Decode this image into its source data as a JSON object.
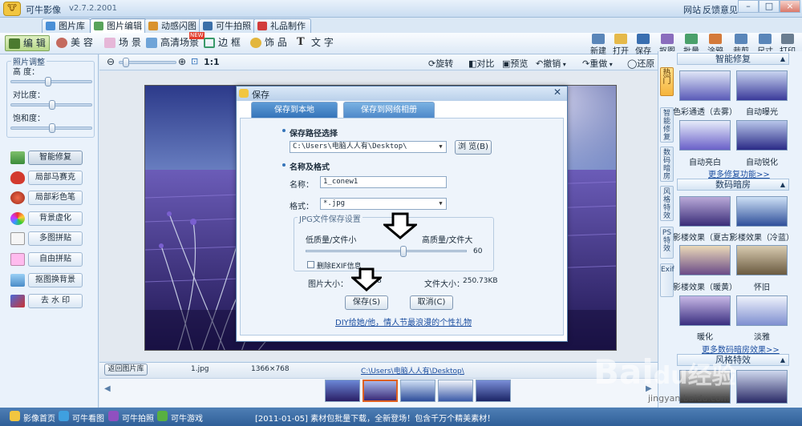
{
  "app": {
    "title": "可牛影像",
    "version": "v2.7.2.2001",
    "logo_icon": "cow-logo-icon"
  },
  "top_tabs": [
    {
      "label": "图片库",
      "icon": "photo-library-icon",
      "active": false
    },
    {
      "label": "图片编辑",
      "icon": "photo-edit-icon",
      "active": true
    },
    {
      "label": "动感闪图",
      "icon": "flash-anim-icon",
      "active": false
    },
    {
      "label": "可牛拍照",
      "icon": "camera-icon",
      "active": false
    },
    {
      "label": "礼品制作",
      "icon": "gift-icon",
      "active": false
    }
  ],
  "top_right": {
    "links": [
      "网站",
      "反馈意见"
    ],
    "win_buttons": [
      "–",
      "□",
      "×"
    ]
  },
  "edit_modes": [
    {
      "label": "编 辑",
      "active": true
    },
    {
      "label": "美 容"
    },
    {
      "label": "场 景"
    },
    {
      "label": "高清场景",
      "badge": "NEW"
    },
    {
      "label": "边 框"
    },
    {
      "label": "饰 品"
    },
    {
      "label": "文 字"
    }
  ],
  "file_tools": [
    "新建",
    "打开",
    "保存",
    "抠图",
    "批量",
    "涂鸦",
    "裁剪",
    "尺寸",
    "打印"
  ],
  "left_panel": {
    "adjust_title": "照片调整",
    "sliders": [
      {
        "label": "高  度：",
        "value": 0.45
      },
      {
        "label": "对比度：",
        "value": 0.5
      },
      {
        "label": "饱和度：",
        "value": 0.5
      }
    ],
    "functions": [
      "智能修复",
      "局部马赛克",
      "局部彩色笔",
      "背景虚化",
      "多图拼贴",
      "自由拼贴",
      "抠图换背景",
      "去 水 印"
    ]
  },
  "center_toolbar": {
    "zoom_label": "1:1",
    "zoom_value": 0.07,
    "tools": [
      "旋转",
      "对比",
      "预览",
      "撤销",
      "重做",
      "还原"
    ]
  },
  "status": {
    "back_btn": "返回图片库",
    "filename": "1.jpg",
    "dimensions": "1366×768",
    "path": "C:\\Users\\电脑人人有\\Desktop\\"
  },
  "right_panel": {
    "vtabs": [
      "热门",
      "智能修复",
      "数码暗房",
      "风格特效",
      "PS特效",
      "Exif"
    ],
    "sections": [
      {
        "title": "智能修复",
        "items": [
          "色彩通透（去雾）",
          "自动曝光",
          "自动亮白",
          "自动锐化"
        ],
        "more": "更多修复功能>>"
      },
      {
        "title": "数码暗房",
        "items": [
          "影楼效果（夏古）",
          "影楼效果（冷蓝）",
          "影楼效果（暖黄）",
          "怀旧",
          "暖化",
          "淡雅"
        ],
        "more": "更多数码暗房效果>>"
      },
      {
        "title": "风格特效"
      }
    ]
  },
  "dialog": {
    "title": "保存",
    "tabs": [
      "保存到本地",
      "保存到网络相册"
    ],
    "path_section": "保存路径选择",
    "path_value": "C:\\Users\\电脑人人有\\Desktop\\",
    "browse_btn": "浏 览(B)",
    "name_section": "名称及格式",
    "name_label": "名称：",
    "name_value": "1_conew1",
    "format_label": "格式：",
    "format_value": "*.jpg",
    "jpg_group": "JPG文件保存设置",
    "low_label": "低质量/文件小",
    "high_label": "高质量/文件大",
    "quality": 60,
    "exif_label": "删除EXIF信息",
    "pic_size_label": "图片大小：",
    "pic_size_value": "8",
    "file_size_label": "文件大小：",
    "file_size_value": "250.73KB",
    "save_btn": "保存(S)",
    "cancel_btn": "取消(C)",
    "promo_link": "DIY给她/他，情人节最浪漫的个性礼物"
  },
  "bottom_bar": {
    "links": [
      "影像首页",
      "可牛看图",
      "可牛拍照",
      "可牛游戏"
    ],
    "news": "[2011-01-05] 素材包批量下载，全新登场！包含千万个精美素材！"
  },
  "watermark": {
    "line1": "Bai",
    "line2": "du经验",
    "url": "jingyan.baidu.com"
  },
  "colors": {
    "accent": "#3574b9",
    "bottom_bar": "#2f5f98",
    "photo_sky": "#7f99d8",
    "photo_field": "#3a2f7a"
  }
}
